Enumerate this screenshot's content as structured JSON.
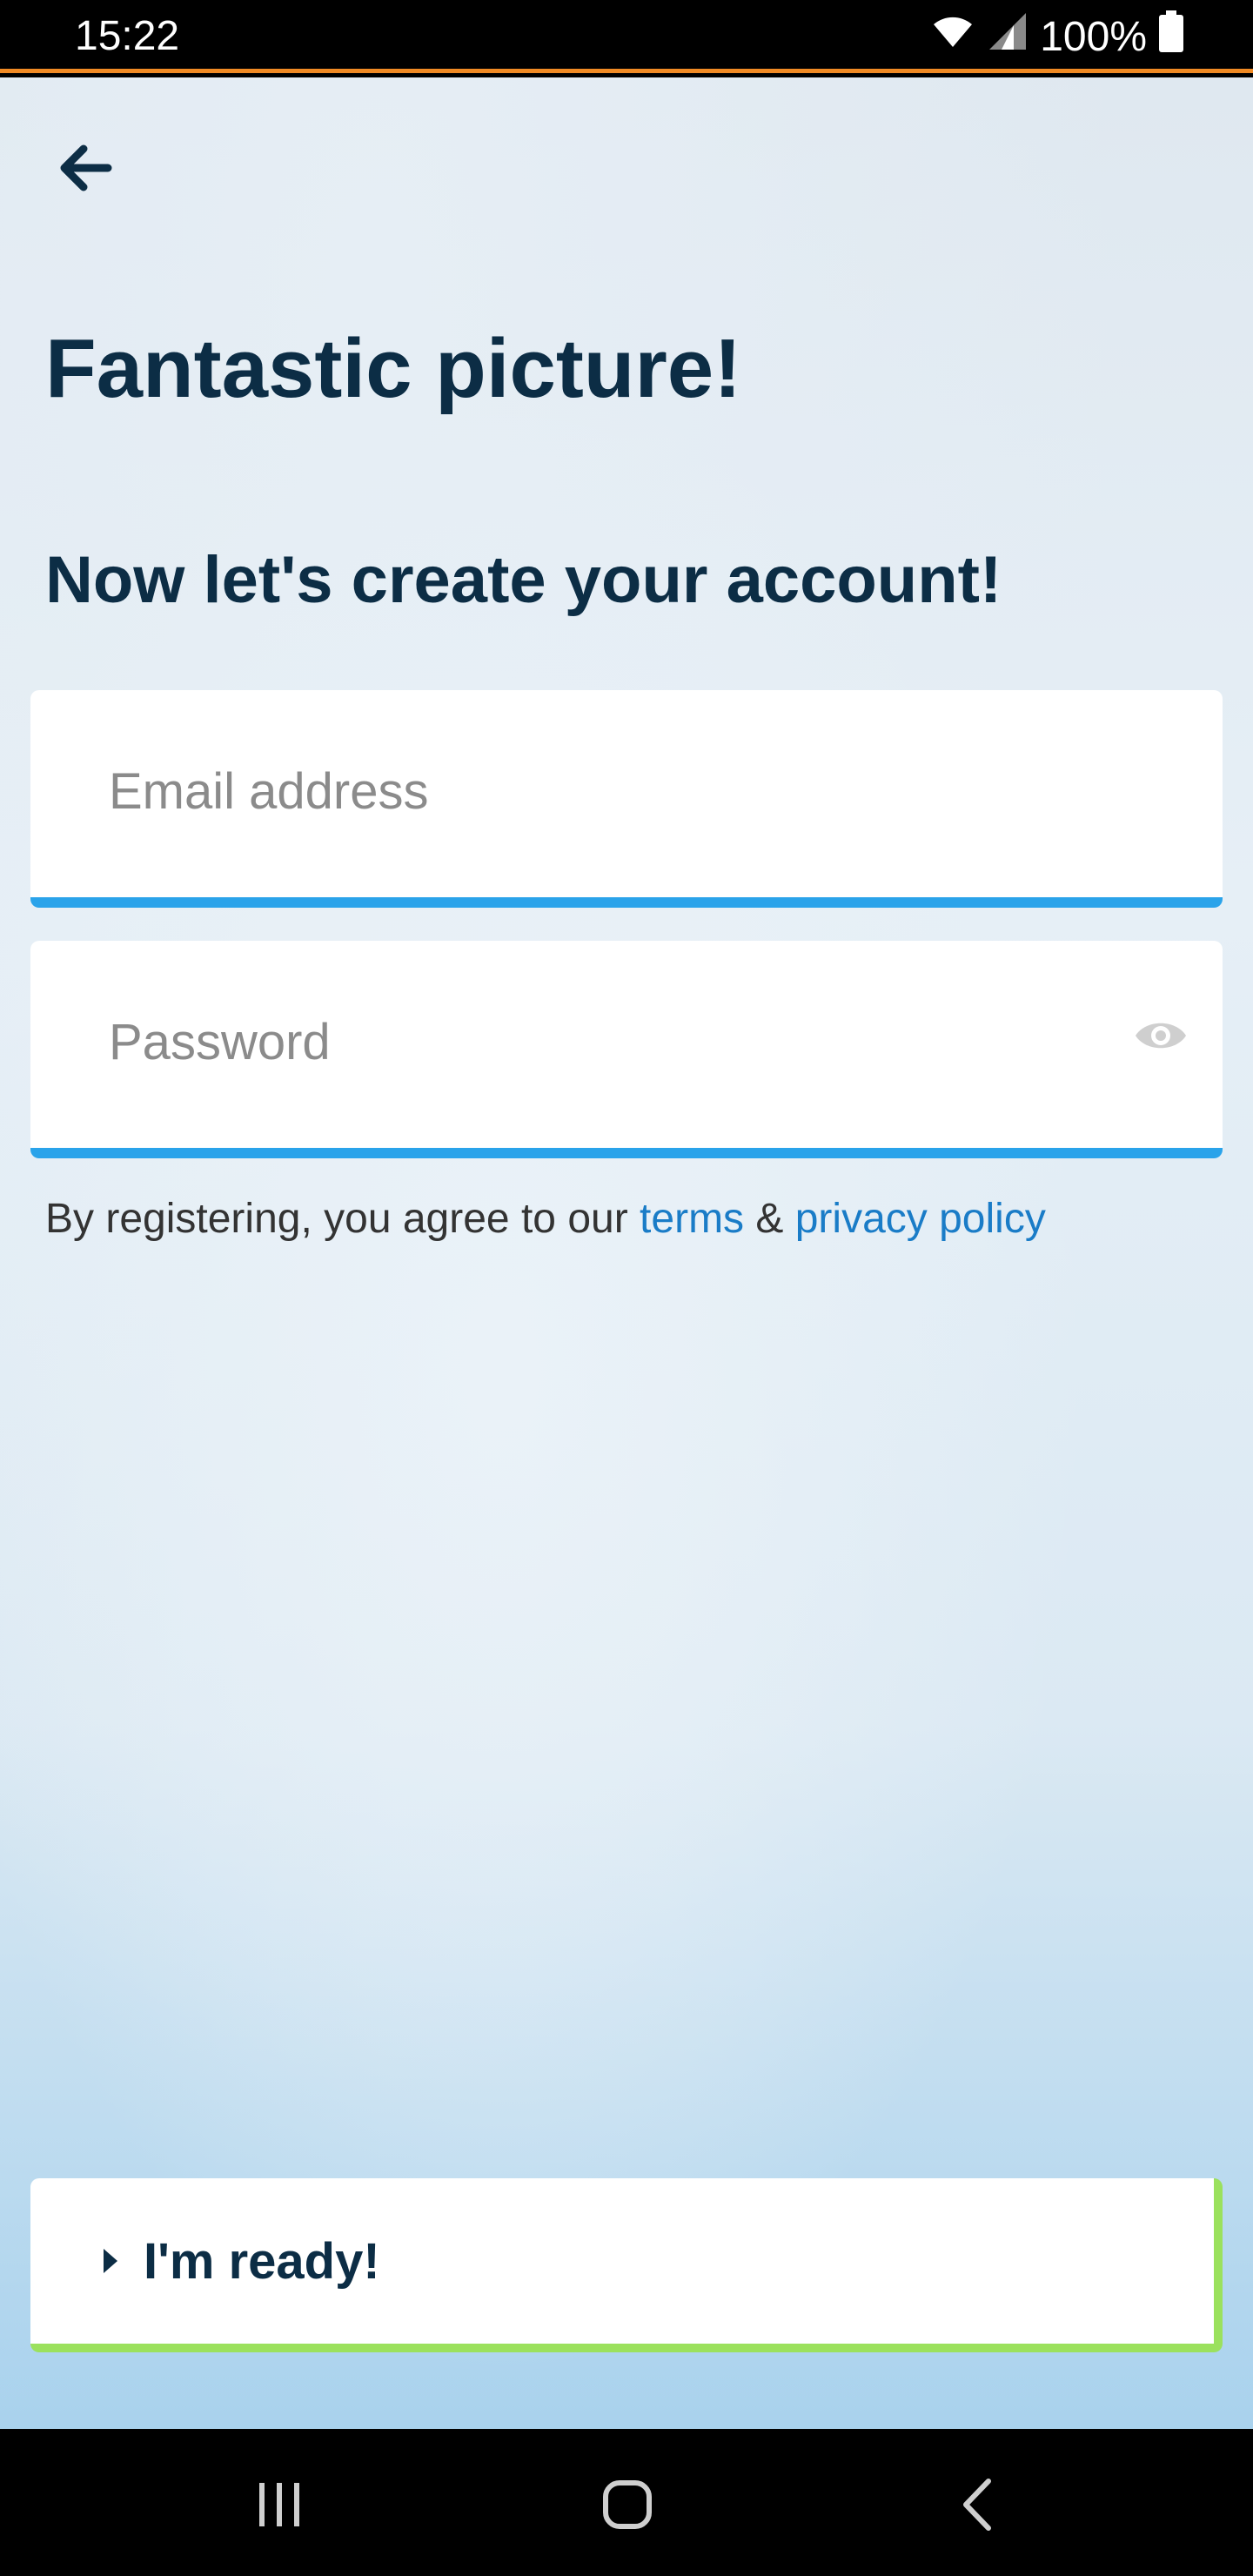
{
  "status_bar": {
    "time": "15:22",
    "battery": "100%",
    "icons": [
      "wifi-icon",
      "signal-icon",
      "battery-icon"
    ]
  },
  "header": {
    "back_icon": "arrow-left-icon"
  },
  "main": {
    "title": "Fantastic picture!",
    "subtitle": "Now let's create your account!",
    "email": {
      "placeholder": "Email address",
      "value": ""
    },
    "password": {
      "placeholder": "Password",
      "value": "",
      "toggle_icon": "eye-icon"
    },
    "legal": {
      "prefix": "By registering, you agree to our ",
      "terms_link": "terms",
      "separator": " & ",
      "privacy_link": "privacy policy"
    },
    "ready_button": {
      "label": "I'm ready!"
    }
  },
  "navigation_bar": {
    "icons": [
      "recents-icon",
      "home-icon",
      "back-icon"
    ]
  },
  "colors": {
    "accent_blue": "#2aa3ea",
    "link_blue": "#1a7cc7",
    "heading_navy": "#0c2d45",
    "ready_green": "#9be15d",
    "status_orange": "#f08a24"
  }
}
